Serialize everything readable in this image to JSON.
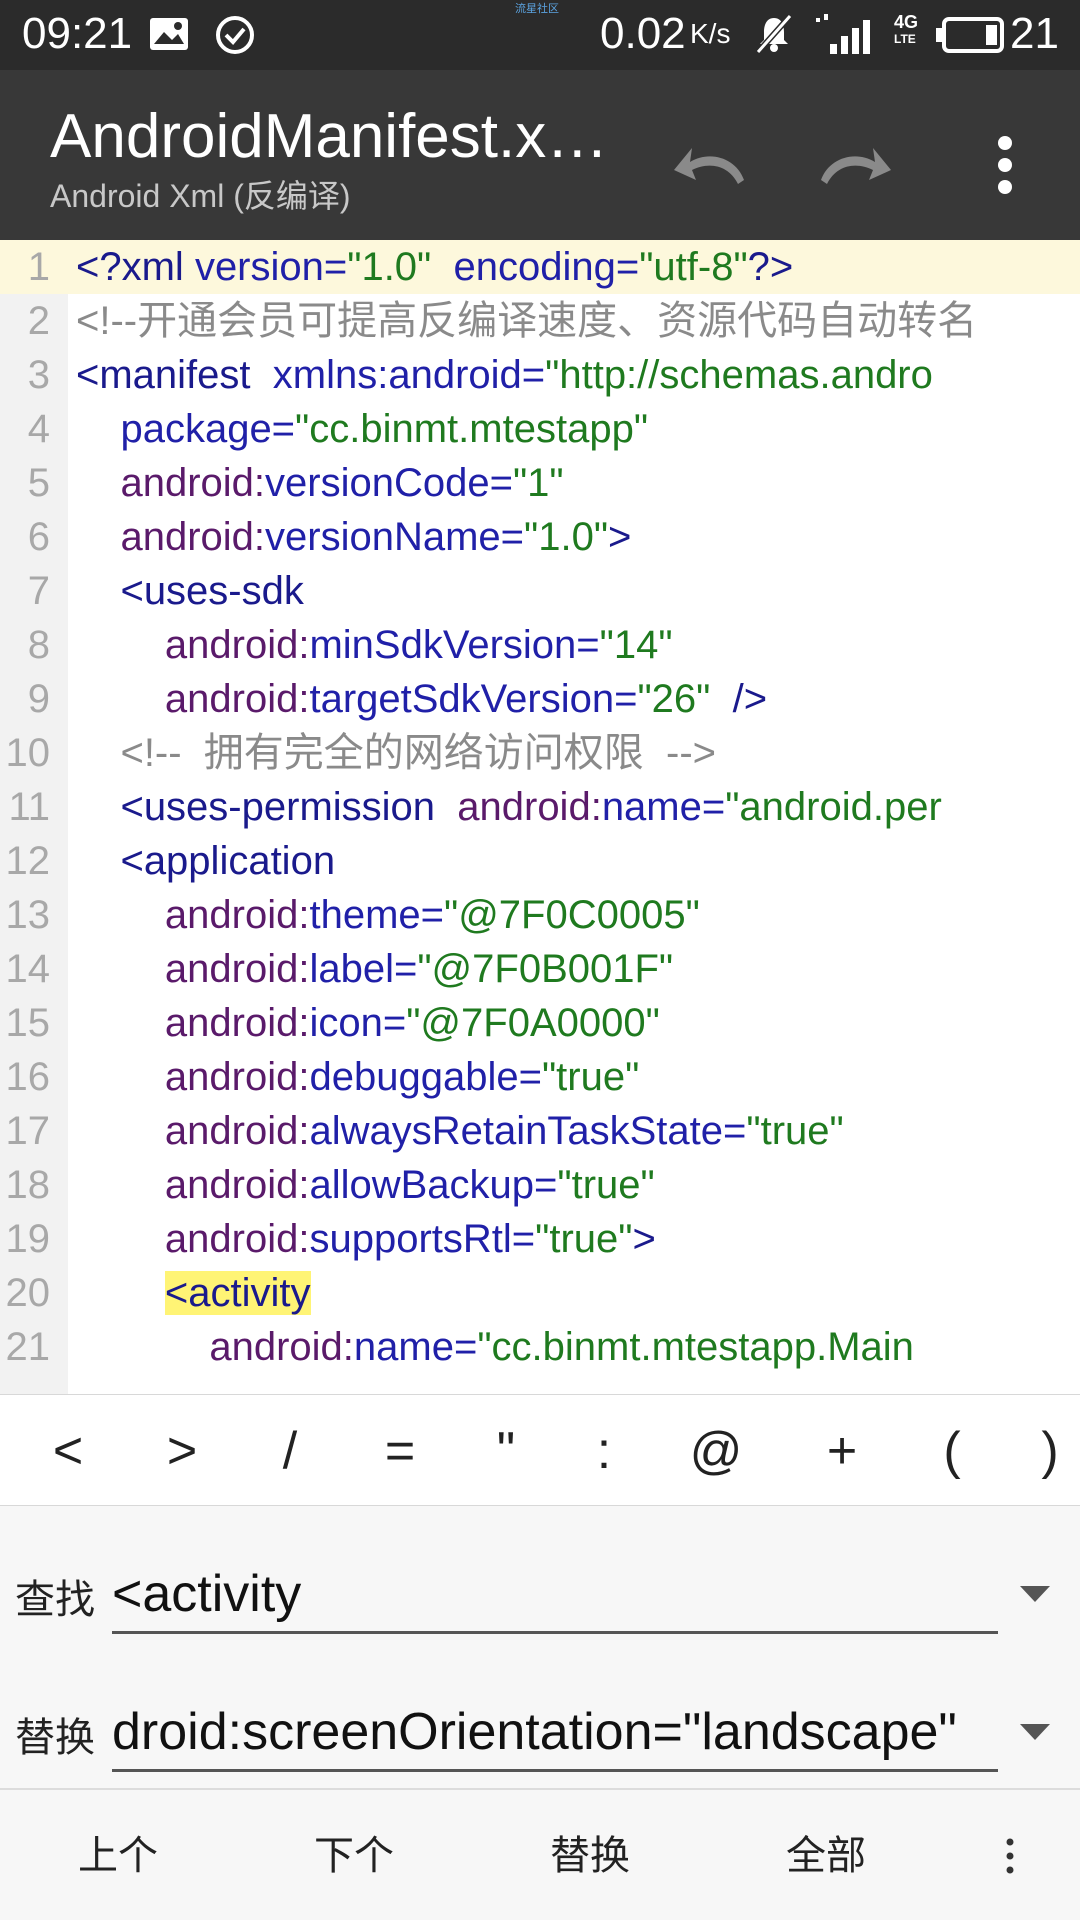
{
  "status_bar": {
    "time": "09:21",
    "center_text": "流星社区",
    "net_speed": "0.02",
    "net_speed_unit": "K/s",
    "network_type": "4G",
    "battery_level": "21",
    "icons": [
      "image-icon",
      "check-circle-icon",
      "mute-icon",
      "signal-icon",
      "battery-icon"
    ]
  },
  "toolbar": {
    "title": "AndroidManifest.xml",
    "subtitle": "Android Xml (反编译)",
    "icons": [
      "undo-icon",
      "redo-icon",
      "more-vert-icon"
    ]
  },
  "editor": {
    "lines": [
      {
        "n": "1",
        "tokens": [
          {
            "t": "tag",
            "v": "<?xml "
          },
          {
            "t": "attrb",
            "v": "version="
          },
          {
            "t": "str",
            "v": "\"1.0\""
          },
          {
            "t": "attrb",
            "v": "  encoding="
          },
          {
            "t": "str",
            "v": "\"utf-8\""
          },
          {
            "t": "tag",
            "v": "?>"
          }
        ]
      },
      {
        "n": "2",
        "tokens": [
          {
            "t": "com",
            "v": "<!--开通会员可提高反编译速度、资源代码自动转名"
          }
        ]
      },
      {
        "n": "3",
        "tokens": [
          {
            "t": "tag",
            "v": "<manifest "
          },
          {
            "t": "attrb",
            "v": " xmlns:android="
          },
          {
            "t": "str",
            "v": "\"http://schemas.andro"
          }
        ]
      },
      {
        "n": "4",
        "tokens": [
          {
            "t": "attrb",
            "v": "    package="
          },
          {
            "t": "str",
            "v": "\"cc.binmt.mtestapp\""
          }
        ]
      },
      {
        "n": "5",
        "tokens": [
          {
            "t": "attr",
            "v": "    android:"
          },
          {
            "t": "attrb",
            "v": "versionCode="
          },
          {
            "t": "str",
            "v": "\"1\""
          }
        ]
      },
      {
        "n": "6",
        "tokens": [
          {
            "t": "attr",
            "v": "    android:"
          },
          {
            "t": "attrb",
            "v": "versionName="
          },
          {
            "t": "str",
            "v": "\"1.0\""
          },
          {
            "t": "tag",
            "v": ">"
          }
        ]
      },
      {
        "n": "7",
        "tokens": [
          {
            "t": "tag",
            "v": "    <uses-sdk"
          }
        ]
      },
      {
        "n": "8",
        "tokens": [
          {
            "t": "attr",
            "v": "        android:"
          },
          {
            "t": "attrb",
            "v": "minSdkVersion="
          },
          {
            "t": "str",
            "v": "\"14\""
          }
        ]
      },
      {
        "n": "9",
        "tokens": [
          {
            "t": "attr",
            "v": "        android:"
          },
          {
            "t": "attrb",
            "v": "targetSdkVersion="
          },
          {
            "t": "str",
            "v": "\"26\""
          },
          {
            "t": "tag",
            "v": "  />"
          }
        ]
      },
      {
        "n": "10",
        "tokens": [
          {
            "t": "com",
            "v": "    <!--  拥有完全的网络访问权限  -->"
          }
        ]
      },
      {
        "n": "11",
        "tokens": [
          {
            "t": "tag",
            "v": "    <uses-permission "
          },
          {
            "t": "attr",
            "v": " android:"
          },
          {
            "t": "attrb",
            "v": "name="
          },
          {
            "t": "str",
            "v": "\"android.per"
          }
        ]
      },
      {
        "n": "12",
        "tokens": [
          {
            "t": "tag",
            "v": "    <application"
          }
        ]
      },
      {
        "n": "13",
        "tokens": [
          {
            "t": "attr",
            "v": "        android:"
          },
          {
            "t": "attrb",
            "v": "theme="
          },
          {
            "t": "str",
            "v": "\"@7F0C0005\""
          }
        ]
      },
      {
        "n": "14",
        "tokens": [
          {
            "t": "attr",
            "v": "        android:"
          },
          {
            "t": "attrb",
            "v": "label="
          },
          {
            "t": "str",
            "v": "\"@7F0B001F\""
          }
        ]
      },
      {
        "n": "15",
        "tokens": [
          {
            "t": "attr",
            "v": "        android:"
          },
          {
            "t": "attrb",
            "v": "icon="
          },
          {
            "t": "str",
            "v": "\"@7F0A0000\""
          }
        ]
      },
      {
        "n": "16",
        "tokens": [
          {
            "t": "attr",
            "v": "        android:"
          },
          {
            "t": "attrb",
            "v": "debuggable="
          },
          {
            "t": "str",
            "v": "\"true\""
          }
        ]
      },
      {
        "n": "17",
        "tokens": [
          {
            "t": "attr",
            "v": "        android:"
          },
          {
            "t": "attrb",
            "v": "alwaysRetainTaskState="
          },
          {
            "t": "str",
            "v": "\"true\""
          }
        ]
      },
      {
        "n": "18",
        "tokens": [
          {
            "t": "attr",
            "v": "        android:"
          },
          {
            "t": "attrb",
            "v": "allowBackup="
          },
          {
            "t": "str",
            "v": "\"true\""
          }
        ]
      },
      {
        "n": "19",
        "tokens": [
          {
            "t": "attr",
            "v": "        android:"
          },
          {
            "t": "attrb",
            "v": "supportsRtl="
          },
          {
            "t": "str",
            "v": "\"true\""
          },
          {
            "t": "tag",
            "v": ">"
          }
        ]
      },
      {
        "n": "20",
        "tokens": [
          {
            "t": "tag",
            "v": "        "
          },
          {
            "t": "hl",
            "v": "<activity"
          }
        ]
      },
      {
        "n": "21",
        "tokens": [
          {
            "t": "attr",
            "v": "            android:"
          },
          {
            "t": "attrb",
            "v": "name="
          },
          {
            "t": "str",
            "v": "\"cc.binmt.mtestapp.Main"
          }
        ]
      }
    ]
  },
  "symbols": [
    "<",
    ">",
    "/",
    "=",
    "\"",
    ":",
    "@",
    "+",
    "(",
    ")"
  ],
  "find_replace": {
    "find_label": "查找",
    "find_value": "<activity",
    "replace_label": "替换",
    "replace_value": "droid:screenOrientation=\"landscape\""
  },
  "actions": {
    "prev": "上个",
    "next": "下个",
    "replace": "替换",
    "all": "全部"
  }
}
